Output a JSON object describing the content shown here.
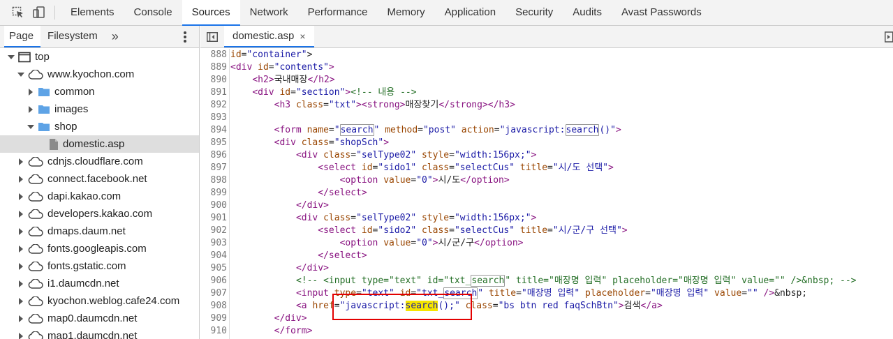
{
  "toolbar": {
    "icons": [
      "inspect-element-icon",
      "device-toolbar-icon"
    ],
    "tabs": [
      "Elements",
      "Console",
      "Sources",
      "Network",
      "Performance",
      "Memory",
      "Application",
      "Security",
      "Audits",
      "Avast Passwords"
    ],
    "active_tab": "Sources"
  },
  "navigator": {
    "tabs": [
      "Page",
      "Filesystem"
    ],
    "more": "»",
    "tree": [
      {
        "label": "top",
        "level": 0,
        "expanded": true,
        "icon": "frame-icon"
      },
      {
        "label": "www.kyochon.com",
        "level": 1,
        "expanded": true,
        "icon": "cloud-icon"
      },
      {
        "label": "common",
        "level": 2,
        "expanded": false,
        "icon": "folder-icon"
      },
      {
        "label": "images",
        "level": 2,
        "expanded": false,
        "icon": "folder-icon"
      },
      {
        "label": "shop",
        "level": 2,
        "expanded": true,
        "icon": "folder-icon"
      },
      {
        "label": "domestic.asp",
        "level": 3,
        "file": true,
        "selected": true,
        "icon": "file-icon"
      },
      {
        "label": "cdnjs.cloudflare.com",
        "level": 1,
        "expanded": false,
        "icon": "cloud-icon"
      },
      {
        "label": "connect.facebook.net",
        "level": 1,
        "expanded": false,
        "icon": "cloud-icon"
      },
      {
        "label": "dapi.kakao.com",
        "level": 1,
        "expanded": false,
        "icon": "cloud-icon"
      },
      {
        "label": "developers.kakao.com",
        "level": 1,
        "expanded": false,
        "icon": "cloud-icon"
      },
      {
        "label": "dmaps.daum.net",
        "level": 1,
        "expanded": false,
        "icon": "cloud-icon"
      },
      {
        "label": "fonts.googleapis.com",
        "level": 1,
        "expanded": false,
        "icon": "cloud-icon"
      },
      {
        "label": "fonts.gstatic.com",
        "level": 1,
        "expanded": false,
        "icon": "cloud-icon"
      },
      {
        "label": "i1.daumcdn.net",
        "level": 1,
        "expanded": false,
        "icon": "cloud-icon"
      },
      {
        "label": "kyochon.weblog.cafe24.com",
        "level": 1,
        "expanded": false,
        "icon": "cloud-icon"
      },
      {
        "label": "map0.daumcdn.net",
        "level": 1,
        "expanded": false,
        "icon": "cloud-icon"
      },
      {
        "label": "map1.daumcdn.net",
        "level": 1,
        "expanded": false,
        "icon": "cloud-icon"
      }
    ]
  },
  "editor": {
    "file_tab": "domestic.asp",
    "close_glyph": "×",
    "lines": [
      {
        "n": "888",
        "indent": 0,
        "html": "<span class=\"a\">id</span>=<span class=\"v\">\"container\"</span>&gt;"
      },
      {
        "n": "889",
        "indent": 0,
        "html": "<span class=\"t\">&lt;div</span> <span class=\"a\">id</span>=<span class=\"v\">\"contents\"</span><span class=\"t\">&gt;</span>"
      },
      {
        "n": "890",
        "indent": 4,
        "html": "<span class=\"t\">&lt;h2&gt;</span>국내매장<span class=\"t\">&lt;/h2&gt;</span>"
      },
      {
        "n": "891",
        "indent": 4,
        "html": "<span class=\"t\">&lt;div</span> <span class=\"a\">id</span>=<span class=\"v\">\"section\"</span><span class=\"t\">&gt;</span><span class=\"c\">&lt;!-- 내용 --&gt;</span>"
      },
      {
        "n": "892",
        "indent": 8,
        "html": "<span class=\"t\">&lt;h3</span> <span class=\"a\">class</span>=<span class=\"v\">\"txt\"</span><span class=\"t\">&gt;&lt;strong&gt;</span>매장찾기<span class=\"t\">&lt;/strong&gt;&lt;/h3&gt;</span>"
      },
      {
        "n": "893",
        "indent": 0,
        "html": ""
      },
      {
        "n": "894",
        "indent": 8,
        "html": "<span class=\"t\">&lt;form</span> <span class=\"a\">name</span>=<span class=\"v\">\"<span class=\"hlbox\">search</span>\"</span> <span class=\"a\">method</span>=<span class=\"v\">\"post\"</span> <span class=\"a\">action</span>=<span class=\"v\">\"javascript:<span class=\"hlbox\">search</span>()\"</span><span class=\"t\">&gt;</span>"
      },
      {
        "n": "895",
        "indent": 8,
        "html": "<span class=\"t\">&lt;div</span> <span class=\"a\">class</span>=<span class=\"v\">\"shopSch\"</span><span class=\"t\">&gt;</span>"
      },
      {
        "n": "896",
        "indent": 12,
        "html": "<span class=\"t\">&lt;div</span> <span class=\"a\">class</span>=<span class=\"v\">\"selType02\"</span> <span class=\"a\">style</span>=<span class=\"v\">\"width:156px;\"</span><span class=\"t\">&gt;</span>"
      },
      {
        "n": "897",
        "indent": 16,
        "html": "<span class=\"t\">&lt;select</span> <span class=\"a\">id</span>=<span class=\"v\">\"sido1\"</span> <span class=\"a\">class</span>=<span class=\"v\">\"selectCus\"</span> <span class=\"a\">title</span>=<span class=\"v\">\"시/도 선택\"</span><span class=\"t\">&gt;</span>"
      },
      {
        "n": "898",
        "indent": 20,
        "html": "<span class=\"t\">&lt;option</span> <span class=\"a\">value</span>=<span class=\"v\">\"0\"</span><span class=\"t\">&gt;</span>시/도<span class=\"t\">&lt;/option&gt;</span>"
      },
      {
        "n": "899",
        "indent": 16,
        "html": "<span class=\"t\">&lt;/select&gt;</span>"
      },
      {
        "n": "900",
        "indent": 12,
        "html": "<span class=\"t\">&lt;/div&gt;</span>"
      },
      {
        "n": "901",
        "indent": 12,
        "html": "<span class=\"t\">&lt;div</span> <span class=\"a\">class</span>=<span class=\"v\">\"selType02\"</span> <span class=\"a\">style</span>=<span class=\"v\">\"width:156px;\"</span><span class=\"t\">&gt;</span>"
      },
      {
        "n": "902",
        "indent": 16,
        "html": "<span class=\"t\">&lt;select</span> <span class=\"a\">id</span>=<span class=\"v\">\"sido2\"</span> <span class=\"a\">class</span>=<span class=\"v\">\"selectCus\"</span> <span class=\"a\">title</span>=<span class=\"v\">\"시/군/구 선택\"</span><span class=\"t\">&gt;</span>"
      },
      {
        "n": "903",
        "indent": 20,
        "html": "<span class=\"t\">&lt;option</span> <span class=\"a\">value</span>=<span class=\"v\">\"0\"</span><span class=\"t\">&gt;</span>시/군/구<span class=\"t\">&lt;/option&gt;</span>"
      },
      {
        "n": "904",
        "indent": 16,
        "html": "<span class=\"t\">&lt;/select&gt;</span>"
      },
      {
        "n": "905",
        "indent": 12,
        "html": "<span class=\"t\">&lt;/div&gt;</span>"
      },
      {
        "n": "906",
        "indent": 12,
        "html": "<span class=\"c\">&lt;!-- &lt;input type=\"text\" id=\"txt_<span class=\"hlbox\">search</span>\" title=\"매장명 입력\" placeholder=\"매장명 입력\" value=\"\" /&gt;&amp;nbsp; --&gt;</span>"
      },
      {
        "n": "907",
        "indent": 12,
        "html": "<span class=\"t\">&lt;input</span> <span class=\"a\">type</span>=<span class=\"v\">\"text\"</span> <span class=\"a\">id</span>=<span class=\"v\">\"txt_<span class=\"hlbox\">search</span>\"</span> <span class=\"a\">title</span>=<span class=\"v\">\"매장명 입력\"</span> <span class=\"a\">placeholder</span>=<span class=\"v\">\"매장명 입력\"</span> <span class=\"a\">value</span>=<span class=\"v\">\"\"</span> <span class=\"t\">/&gt;</span>&amp;nbsp;"
      },
      {
        "n": "908",
        "indent": 12,
        "html": "<span class=\"t\">&lt;a</span> <span class=\"a\">href</span>=<span class=\"v\">\"javascript:<span class=\"hlyellow\">search</span>();\"</span> <span class=\"a\">class</span>=<span class=\"v\">\"bs btn red faqSchBtn\"</span><span class=\"t\">&gt;</span>검색<span class=\"t\">&lt;/a&gt;</span>"
      },
      {
        "n": "909",
        "indent": 8,
        "html": "<span class=\"t\">&lt;/div&gt;</span>"
      },
      {
        "n": "910",
        "indent": 8,
        "html": "<span class=\"t\">&lt;/form&gt;</span>"
      }
    ]
  },
  "colors": {
    "accent": "#1a73e8",
    "annotation_box": "#e30000",
    "highlight": "#f6e500",
    "folder": "#5ea3e6"
  }
}
